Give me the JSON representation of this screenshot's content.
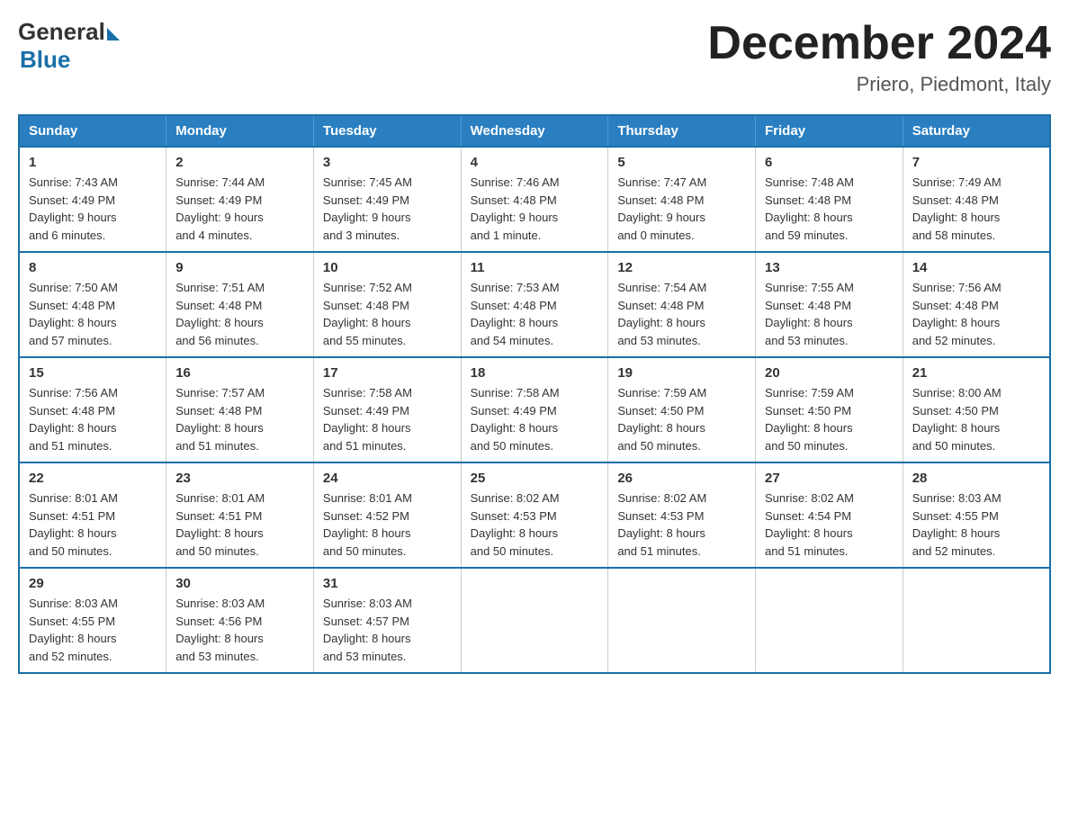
{
  "header": {
    "logo_general": "General",
    "logo_blue": "Blue",
    "month_title": "December 2024",
    "subtitle": "Priero, Piedmont, Italy"
  },
  "days_of_week": [
    "Sunday",
    "Monday",
    "Tuesday",
    "Wednesday",
    "Thursday",
    "Friday",
    "Saturday"
  ],
  "weeks": [
    [
      {
        "day": "1",
        "sunrise": "7:43 AM",
        "sunset": "4:49 PM",
        "daylight": "9 hours and 6 minutes."
      },
      {
        "day": "2",
        "sunrise": "7:44 AM",
        "sunset": "4:49 PM",
        "daylight": "9 hours and 4 minutes."
      },
      {
        "day": "3",
        "sunrise": "7:45 AM",
        "sunset": "4:49 PM",
        "daylight": "9 hours and 3 minutes."
      },
      {
        "day": "4",
        "sunrise": "7:46 AM",
        "sunset": "4:48 PM",
        "daylight": "9 hours and 1 minute."
      },
      {
        "day": "5",
        "sunrise": "7:47 AM",
        "sunset": "4:48 PM",
        "daylight": "9 hours and 0 minutes."
      },
      {
        "day": "6",
        "sunrise": "7:48 AM",
        "sunset": "4:48 PM",
        "daylight": "8 hours and 59 minutes."
      },
      {
        "day": "7",
        "sunrise": "7:49 AM",
        "sunset": "4:48 PM",
        "daylight": "8 hours and 58 minutes."
      }
    ],
    [
      {
        "day": "8",
        "sunrise": "7:50 AM",
        "sunset": "4:48 PM",
        "daylight": "8 hours and 57 minutes."
      },
      {
        "day": "9",
        "sunrise": "7:51 AM",
        "sunset": "4:48 PM",
        "daylight": "8 hours and 56 minutes."
      },
      {
        "day": "10",
        "sunrise": "7:52 AM",
        "sunset": "4:48 PM",
        "daylight": "8 hours and 55 minutes."
      },
      {
        "day": "11",
        "sunrise": "7:53 AM",
        "sunset": "4:48 PM",
        "daylight": "8 hours and 54 minutes."
      },
      {
        "day": "12",
        "sunrise": "7:54 AM",
        "sunset": "4:48 PM",
        "daylight": "8 hours and 53 minutes."
      },
      {
        "day": "13",
        "sunrise": "7:55 AM",
        "sunset": "4:48 PM",
        "daylight": "8 hours and 53 minutes."
      },
      {
        "day": "14",
        "sunrise": "7:56 AM",
        "sunset": "4:48 PM",
        "daylight": "8 hours and 52 minutes."
      }
    ],
    [
      {
        "day": "15",
        "sunrise": "7:56 AM",
        "sunset": "4:48 PM",
        "daylight": "8 hours and 51 minutes."
      },
      {
        "day": "16",
        "sunrise": "7:57 AM",
        "sunset": "4:48 PM",
        "daylight": "8 hours and 51 minutes."
      },
      {
        "day": "17",
        "sunrise": "7:58 AM",
        "sunset": "4:49 PM",
        "daylight": "8 hours and 51 minutes."
      },
      {
        "day": "18",
        "sunrise": "7:58 AM",
        "sunset": "4:49 PM",
        "daylight": "8 hours and 50 minutes."
      },
      {
        "day": "19",
        "sunrise": "7:59 AM",
        "sunset": "4:50 PM",
        "daylight": "8 hours and 50 minutes."
      },
      {
        "day": "20",
        "sunrise": "7:59 AM",
        "sunset": "4:50 PM",
        "daylight": "8 hours and 50 minutes."
      },
      {
        "day": "21",
        "sunrise": "8:00 AM",
        "sunset": "4:50 PM",
        "daylight": "8 hours and 50 minutes."
      }
    ],
    [
      {
        "day": "22",
        "sunrise": "8:01 AM",
        "sunset": "4:51 PM",
        "daylight": "8 hours and 50 minutes."
      },
      {
        "day": "23",
        "sunrise": "8:01 AM",
        "sunset": "4:51 PM",
        "daylight": "8 hours and 50 minutes."
      },
      {
        "day": "24",
        "sunrise": "8:01 AM",
        "sunset": "4:52 PM",
        "daylight": "8 hours and 50 minutes."
      },
      {
        "day": "25",
        "sunrise": "8:02 AM",
        "sunset": "4:53 PM",
        "daylight": "8 hours and 50 minutes."
      },
      {
        "day": "26",
        "sunrise": "8:02 AM",
        "sunset": "4:53 PM",
        "daylight": "8 hours and 51 minutes."
      },
      {
        "day": "27",
        "sunrise": "8:02 AM",
        "sunset": "4:54 PM",
        "daylight": "8 hours and 51 minutes."
      },
      {
        "day": "28",
        "sunrise": "8:03 AM",
        "sunset": "4:55 PM",
        "daylight": "8 hours and 52 minutes."
      }
    ],
    [
      {
        "day": "29",
        "sunrise": "8:03 AM",
        "sunset": "4:55 PM",
        "daylight": "8 hours and 52 minutes."
      },
      {
        "day": "30",
        "sunrise": "8:03 AM",
        "sunset": "4:56 PM",
        "daylight": "8 hours and 53 minutes."
      },
      {
        "day": "31",
        "sunrise": "8:03 AM",
        "sunset": "4:57 PM",
        "daylight": "8 hours and 53 minutes."
      },
      null,
      null,
      null,
      null
    ]
  ],
  "labels": {
    "sunrise": "Sunrise:",
    "sunset": "Sunset:",
    "daylight": "Daylight:"
  }
}
